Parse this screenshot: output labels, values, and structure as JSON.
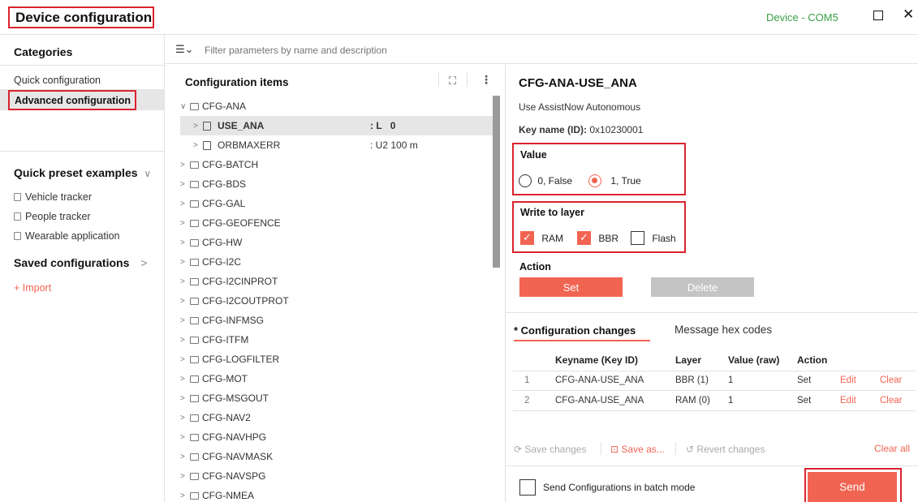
{
  "app_title": "Device configuration",
  "device_label": "Device - COM5",
  "sidebar": {
    "categories_title": "Categories",
    "items": [
      "Quick configuration",
      "Advanced configuration"
    ],
    "presets_title": "Quick preset examples",
    "presets": [
      "Vehicle tracker",
      "People tracker",
      "Wearable application"
    ],
    "saved_title": "Saved configurations",
    "import_label": "+ Import"
  },
  "filter": {
    "placeholder": "Filter parameters by name and description"
  },
  "tree": {
    "title": "Configuration items",
    "root": "CFG-ANA",
    "children": [
      {
        "name": "USE_ANA",
        "type": ": L",
        "value": "0"
      },
      {
        "name": "ORBMAXERR",
        "type": ": U2",
        "value": "100 m"
      }
    ],
    "groups": [
      "CFG-BATCH",
      "CFG-BDS",
      "CFG-GAL",
      "CFG-GEOFENCE",
      "CFG-HW",
      "CFG-I2C",
      "CFG-I2CINPROT",
      "CFG-I2COUTPROT",
      "CFG-INFMSG",
      "CFG-ITFM",
      "CFG-LOGFILTER",
      "CFG-MOT",
      "CFG-MSGOUT",
      "CFG-NAV2",
      "CFG-NAVHPG",
      "CFG-NAVMASK",
      "CFG-NAVSPG",
      "CFG-NMEA"
    ]
  },
  "detail": {
    "title": "CFG-ANA-USE_ANA",
    "description": "Use AssistNow Autonomous",
    "key_label": "Key name (ID):",
    "key_value": "0x10230001",
    "value_label": "Value",
    "value_options": [
      "0, False",
      "1, True"
    ],
    "selected_value": 1,
    "layer_label": "Write to layer",
    "layers": [
      {
        "name": "RAM",
        "checked": true
      },
      {
        "name": "BBR",
        "checked": true
      },
      {
        "name": "Flash",
        "checked": false
      }
    ],
    "action_label": "Action",
    "set_label": "Set",
    "delete_label": "Delete"
  },
  "changes": {
    "tab_active": "* Configuration changes",
    "tab_other": "Message hex codes",
    "headers": [
      "Keyname (Key ID)",
      "Layer",
      "Value (raw)",
      "Action"
    ],
    "rows": [
      {
        "num": "1",
        "key": "CFG-ANA-USE_ANA",
        "layer": "BBR (1)",
        "value": "1",
        "action": "Set",
        "edit": "Edit",
        "clear": "Clear"
      },
      {
        "num": "2",
        "key": "CFG-ANA-USE_ANA",
        "layer": "RAM (0)",
        "value": "1",
        "action": "Set",
        "edit": "Edit",
        "clear": "Clear"
      }
    ],
    "save_changes": "Save changes",
    "save_as": "Save as...",
    "revert": "Revert changes",
    "clear_all": "Clear all",
    "batch_label": "Send Configurations in batch mode",
    "send_label": "Send"
  },
  "colors": {
    "accent": "#f26452",
    "highlight": "#d9232e",
    "device": "#3aa046"
  }
}
